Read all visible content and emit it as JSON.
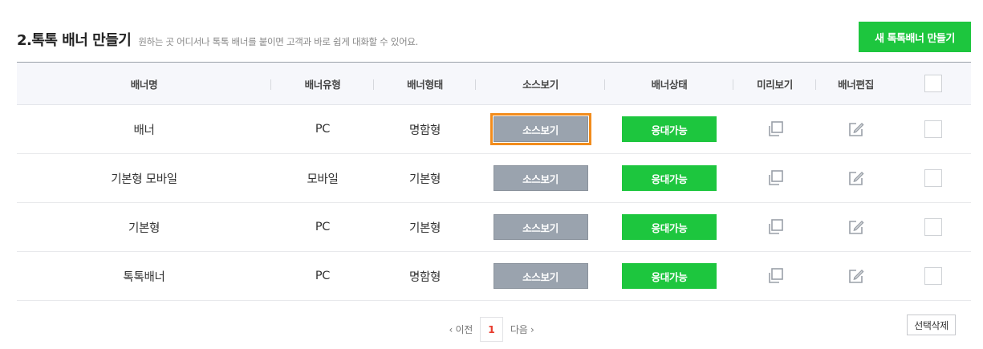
{
  "header": {
    "title": "2.톡톡 배너 만들기",
    "subtitle": "원하는 곳 어디서나 톡톡 배너를 붙이면 고객과 바로 쉽게 대화할 수 있어요.",
    "create_button": "새 톡톡배너 만들기"
  },
  "table": {
    "columns": [
      "배너명",
      "배너유형",
      "배너형태",
      "소스보기",
      "배너상태",
      "미리보기",
      "배너편집"
    ],
    "rows": [
      {
        "name": "배너",
        "type": "PC",
        "form": "명함형",
        "source": "소스보기",
        "status": "응대가능"
      },
      {
        "name": "기본형 모바일",
        "type": "모바일",
        "form": "기본형",
        "source": "소스보기",
        "status": "응대가능"
      },
      {
        "name": "기본형",
        "type": "PC",
        "form": "기본형",
        "source": "소스보기",
        "status": "응대가능"
      },
      {
        "name": "톡톡배너",
        "type": "PC",
        "form": "명함형",
        "source": "소스보기",
        "status": "응대가능"
      }
    ]
  },
  "pagination": {
    "prev": "‹ 이전",
    "current": "1",
    "next": "다음 ›"
  },
  "delete_button": "선택삭제",
  "icons": {
    "preview": "preview-copy-icon",
    "edit": "edit-pencil-icon"
  },
  "colors": {
    "accent_green": "#1dc63e",
    "source_gray": "#9aa3ae",
    "focus_orange": "#f28c1c",
    "page_red": "#e83c2e"
  }
}
